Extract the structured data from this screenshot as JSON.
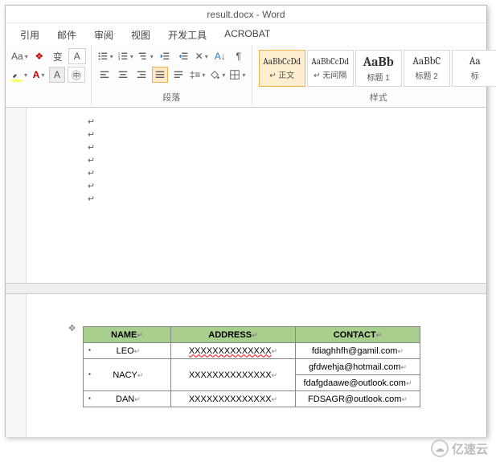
{
  "title": "result.docx - Word",
  "menu": {
    "m0": "引用",
    "m1": "邮件",
    "m2": "审阅",
    "m3": "视图",
    "m4": "开发工具",
    "m5": "ACROBAT"
  },
  "ribbon": {
    "font_btn": "Aa",
    "wen": "变",
    "paragraph_label": "段落",
    "styles_label": "样式"
  },
  "styles": [
    {
      "preview": "AaBbCcDd",
      "label": "↵ 正文",
      "cls": "sm sel"
    },
    {
      "preview": "AaBbCcDd",
      "label": "↵ 无间隔",
      "cls": "sm"
    },
    {
      "preview": "AaBb",
      "label": "标题 1",
      "cls": "big"
    },
    {
      "preview": "AaBbC",
      "label": "标题 2",
      "cls": "med"
    },
    {
      "preview": "Aa",
      "label": "标",
      "cls": "med"
    }
  ],
  "table": {
    "headers": {
      "name": "NAME",
      "address": "ADDRESS",
      "contact": "CONTACT"
    },
    "rows": [
      {
        "name": "LEO",
        "address": "XXXXXXXXXXXXXX",
        "contacts": [
          "fdiaghhfh@gamil.com"
        ],
        "addr_squiggle": true
      },
      {
        "name": "NACY",
        "address": "XXXXXXXXXXXXXX",
        "contacts": [
          "gfdwehja@hotmail.com",
          "fdafgdaawe@outlook.com"
        ],
        "addr_squiggle": false
      },
      {
        "name": "DAN",
        "address": "XXXXXXXXXXXXXX",
        "contacts": [
          "FDSAGR@outlook.com"
        ],
        "addr_squiggle": false
      }
    ]
  },
  "watermark": "亿速云"
}
